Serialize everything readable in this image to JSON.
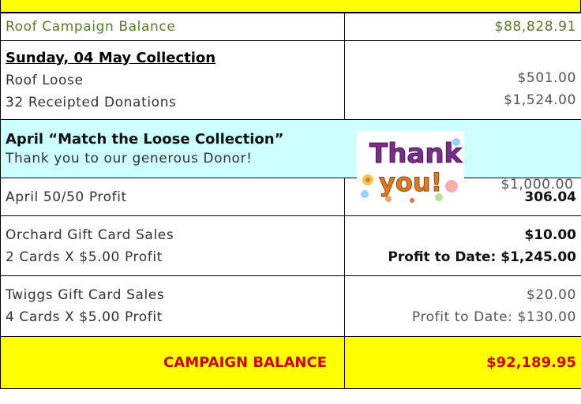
{
  "roof": {
    "label": "Roof Campaign Balance",
    "amount": "$88,828.91"
  },
  "collection": {
    "heading": "Sunday, 04 May Collection",
    "loose_label": "Roof Loose",
    "loose_amount": "$501.00",
    "donations_label": "32 Receipted Donations",
    "donations_amount": "$1,524.00"
  },
  "match": {
    "heading": "April “Match the Loose Collection”",
    "thanks": "Thank you to our generous Donor!",
    "amount": "$1,000.00",
    "sticker_line1": "Thank",
    "sticker_line2": "you!"
  },
  "fiftyfifty": {
    "label": "April 50/50 Profit",
    "amount": "306.04"
  },
  "orchard": {
    "label": "Orchard Gift Card Sales",
    "detail": "2 Cards X $5.00 Profit",
    "amount": "$10.00",
    "to_date": "Profit to Date: $1,245.00"
  },
  "twiggs": {
    "label": "Twiggs Gift Card Sales",
    "detail": "4 Cards X $5.00 Profit",
    "amount": "$20.00",
    "to_date": "Profit to Date: $130.00"
  },
  "total": {
    "label": "CAMPAIGN BALANCE",
    "amount": "$92,189.95"
  },
  "colors": {
    "band": "#ffff00",
    "match_row": "#ccffff",
    "total_text": "#cc0000",
    "roof_text": "#5a7a2a"
  }
}
